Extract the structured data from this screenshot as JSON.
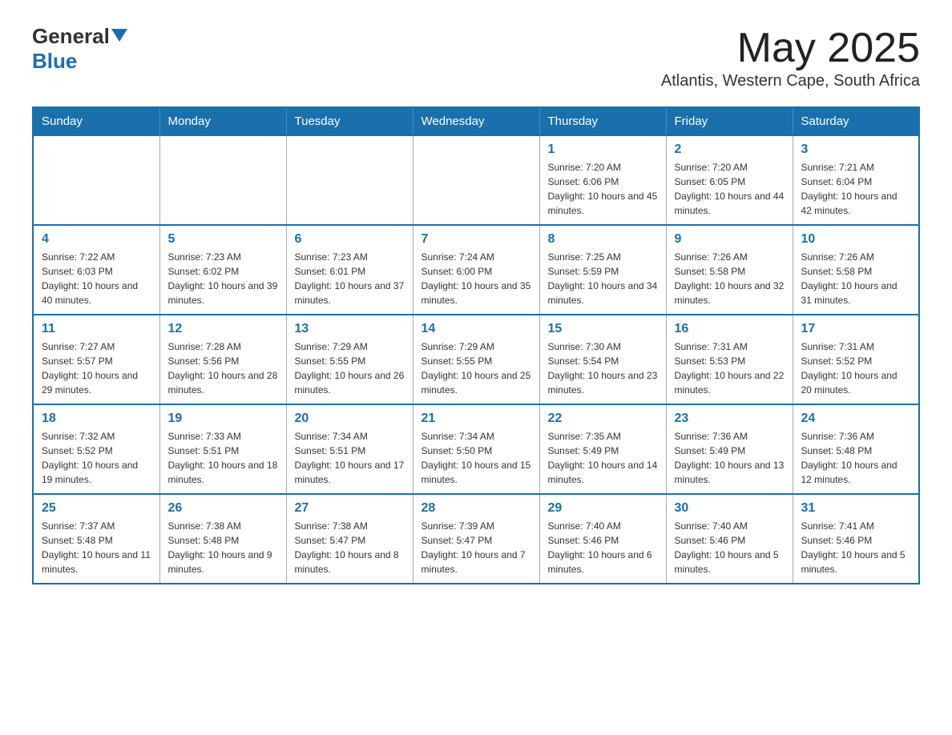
{
  "header": {
    "logo_general": "General",
    "logo_blue": "Blue",
    "month_year": "May 2025",
    "location": "Atlantis, Western Cape, South Africa"
  },
  "days_of_week": [
    "Sunday",
    "Monday",
    "Tuesday",
    "Wednesday",
    "Thursday",
    "Friday",
    "Saturday"
  ],
  "weeks": [
    [
      {
        "day": "",
        "info": ""
      },
      {
        "day": "",
        "info": ""
      },
      {
        "day": "",
        "info": ""
      },
      {
        "day": "",
        "info": ""
      },
      {
        "day": "1",
        "info": "Sunrise: 7:20 AM\nSunset: 6:06 PM\nDaylight: 10 hours and 45 minutes."
      },
      {
        "day": "2",
        "info": "Sunrise: 7:20 AM\nSunset: 6:05 PM\nDaylight: 10 hours and 44 minutes."
      },
      {
        "day": "3",
        "info": "Sunrise: 7:21 AM\nSunset: 6:04 PM\nDaylight: 10 hours and 42 minutes."
      }
    ],
    [
      {
        "day": "4",
        "info": "Sunrise: 7:22 AM\nSunset: 6:03 PM\nDaylight: 10 hours and 40 minutes."
      },
      {
        "day": "5",
        "info": "Sunrise: 7:23 AM\nSunset: 6:02 PM\nDaylight: 10 hours and 39 minutes."
      },
      {
        "day": "6",
        "info": "Sunrise: 7:23 AM\nSunset: 6:01 PM\nDaylight: 10 hours and 37 minutes."
      },
      {
        "day": "7",
        "info": "Sunrise: 7:24 AM\nSunset: 6:00 PM\nDaylight: 10 hours and 35 minutes."
      },
      {
        "day": "8",
        "info": "Sunrise: 7:25 AM\nSunset: 5:59 PM\nDaylight: 10 hours and 34 minutes."
      },
      {
        "day": "9",
        "info": "Sunrise: 7:26 AM\nSunset: 5:58 PM\nDaylight: 10 hours and 32 minutes."
      },
      {
        "day": "10",
        "info": "Sunrise: 7:26 AM\nSunset: 5:58 PM\nDaylight: 10 hours and 31 minutes."
      }
    ],
    [
      {
        "day": "11",
        "info": "Sunrise: 7:27 AM\nSunset: 5:57 PM\nDaylight: 10 hours and 29 minutes."
      },
      {
        "day": "12",
        "info": "Sunrise: 7:28 AM\nSunset: 5:56 PM\nDaylight: 10 hours and 28 minutes."
      },
      {
        "day": "13",
        "info": "Sunrise: 7:29 AM\nSunset: 5:55 PM\nDaylight: 10 hours and 26 minutes."
      },
      {
        "day": "14",
        "info": "Sunrise: 7:29 AM\nSunset: 5:55 PM\nDaylight: 10 hours and 25 minutes."
      },
      {
        "day": "15",
        "info": "Sunrise: 7:30 AM\nSunset: 5:54 PM\nDaylight: 10 hours and 23 minutes."
      },
      {
        "day": "16",
        "info": "Sunrise: 7:31 AM\nSunset: 5:53 PM\nDaylight: 10 hours and 22 minutes."
      },
      {
        "day": "17",
        "info": "Sunrise: 7:31 AM\nSunset: 5:52 PM\nDaylight: 10 hours and 20 minutes."
      }
    ],
    [
      {
        "day": "18",
        "info": "Sunrise: 7:32 AM\nSunset: 5:52 PM\nDaylight: 10 hours and 19 minutes."
      },
      {
        "day": "19",
        "info": "Sunrise: 7:33 AM\nSunset: 5:51 PM\nDaylight: 10 hours and 18 minutes."
      },
      {
        "day": "20",
        "info": "Sunrise: 7:34 AM\nSunset: 5:51 PM\nDaylight: 10 hours and 17 minutes."
      },
      {
        "day": "21",
        "info": "Sunrise: 7:34 AM\nSunset: 5:50 PM\nDaylight: 10 hours and 15 minutes."
      },
      {
        "day": "22",
        "info": "Sunrise: 7:35 AM\nSunset: 5:49 PM\nDaylight: 10 hours and 14 minutes."
      },
      {
        "day": "23",
        "info": "Sunrise: 7:36 AM\nSunset: 5:49 PM\nDaylight: 10 hours and 13 minutes."
      },
      {
        "day": "24",
        "info": "Sunrise: 7:36 AM\nSunset: 5:48 PM\nDaylight: 10 hours and 12 minutes."
      }
    ],
    [
      {
        "day": "25",
        "info": "Sunrise: 7:37 AM\nSunset: 5:48 PM\nDaylight: 10 hours and 11 minutes."
      },
      {
        "day": "26",
        "info": "Sunrise: 7:38 AM\nSunset: 5:48 PM\nDaylight: 10 hours and 9 minutes."
      },
      {
        "day": "27",
        "info": "Sunrise: 7:38 AM\nSunset: 5:47 PM\nDaylight: 10 hours and 8 minutes."
      },
      {
        "day": "28",
        "info": "Sunrise: 7:39 AM\nSunset: 5:47 PM\nDaylight: 10 hours and 7 minutes."
      },
      {
        "day": "29",
        "info": "Sunrise: 7:40 AM\nSunset: 5:46 PM\nDaylight: 10 hours and 6 minutes."
      },
      {
        "day": "30",
        "info": "Sunrise: 7:40 AM\nSunset: 5:46 PM\nDaylight: 10 hours and 5 minutes."
      },
      {
        "day": "31",
        "info": "Sunrise: 7:41 AM\nSunset: 5:46 PM\nDaylight: 10 hours and 5 minutes."
      }
    ]
  ]
}
